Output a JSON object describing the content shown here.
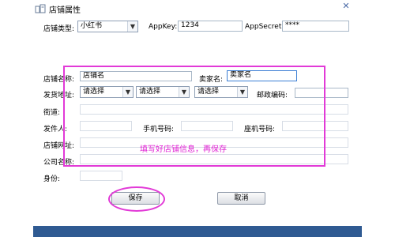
{
  "window": {
    "title": "店铺属性",
    "close_glyph": "✕"
  },
  "store_type": {
    "label": "店铺类型:",
    "value": "小红书"
  },
  "appkey": {
    "label": "AppKey:",
    "value": "1234"
  },
  "appsecret": {
    "label": "AppSecret:",
    "value": "****"
  },
  "store_name": {
    "label": "店铺名称:",
    "value": "店铺名"
  },
  "seller_name": {
    "label": "卖家名:",
    "value": "卖家名"
  },
  "ship_address": {
    "label": "发货地址:",
    "province": "请选择",
    "city": "请选择",
    "district": "请选择"
  },
  "postal_code": {
    "label": "邮政编码:",
    "value": ""
  },
  "street": {
    "label": "街道:",
    "value": ""
  },
  "sender": {
    "label": "发件人:",
    "value": ""
  },
  "mobile": {
    "label": "手机号码:",
    "value": ""
  },
  "phone": {
    "label": "座机号码:",
    "value": ""
  },
  "store_url": {
    "label": "店铺网址:",
    "value": ""
  },
  "company_name": {
    "label": "公司名称:",
    "value": ""
  },
  "identity": {
    "label": "身份:",
    "value": ""
  },
  "buttons": {
    "save": "保存",
    "cancel": "取消"
  },
  "annotation": {
    "text": "填写好店铺信息，再保存",
    "color": "#e023d4"
  },
  "colors": {
    "accent": "#2f5a92",
    "annotation": "#e23ad7"
  }
}
